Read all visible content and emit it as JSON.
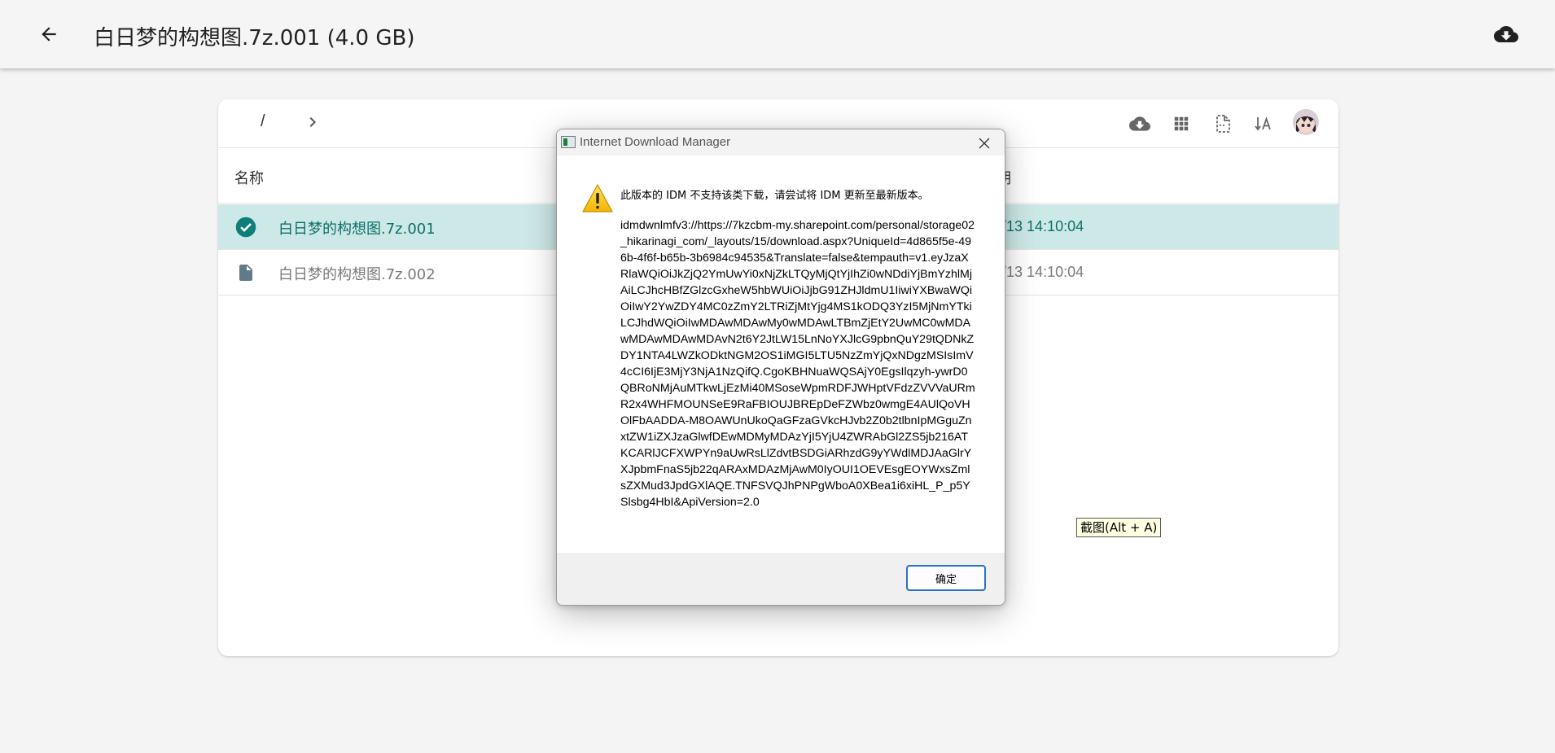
{
  "appbar": {
    "title": "白日梦的构想图.7z.001 (4.0 GB)",
    "back_icon": "arrow-left-icon",
    "download_icon": "cloud-download-icon"
  },
  "explorer": {
    "breadcrumb": {
      "root": "/",
      "separator_icon": "chevron-right-icon"
    },
    "toolbar_icons": [
      "cloud-download-icon",
      "grid-view-icon",
      "file-dashed-icon",
      "sort-text-icon",
      "avatar"
    ],
    "columns": {
      "name": "名称",
      "date_partial": "日期"
    },
    "rows": [
      {
        "name": "白日梦的构想图.7z.001",
        "date_partial": "4/8/13 14:10:04",
        "icon": "check-circle-icon",
        "selected": true
      },
      {
        "name": "白日梦的构想图.7z.002",
        "date_partial": "4/8/13 14:10:04",
        "icon": "file-icon",
        "selected": false
      }
    ]
  },
  "tooltip": {
    "text": "截图(Alt + A)"
  },
  "dialog": {
    "title": "Internet Download Manager",
    "message": "此版本的 IDM 不支持该类下载，请尝试将 IDM 更新至最新版本。",
    "url": "idmdwnlmfv3://https://7kzcbm-my.sharepoint.com/personal/storage02_hikarinagi_com/_layouts/15/download.aspx?UniqueId=4d865f5e-496b-4f6f-b65b-3b6984c94535&Translate=false&tempauth=v1.eyJzaXRlaWQiOiJkZjQ2YmUwYi0xNjZkLTQyMjQtYjIhZi0wNDdiYjBmYzhlMjAiLCJhcHBfZGlzcGxheW5hbWUiOiJjbG91ZHJldmU1IiwiYXBwaWQiOiIwY2YwZDY4MC0zZmY2LTRiZjMtYjg4MS1kODQ3YzI5MjNmYTkiLCJhdWQiOiIwMDAwMDAwMy0wMDAwLTBmZjEtY2UwMC0wMDAwMDAwMDAwMDAvN2t6Y2JtLW15LnNoYXJlcG9pbnQuY29tQDNkZDY1NTA4LWZkODktNGM2OS1iMGI5LTU5NzZmYjQxNDgzMSIsImV4cCI6IjE3MjY3NjA1NzQifQ.CgoKBHNuaWQSAjY0EgsIlqzyh-ywrD0QBRoNMjAuMTkwLjEzMi40MSoseWpmRDFJWHptVFdzZVVVaURmR2x4WHFMOUNSeE9RaFBIOUJBREpDeFZWbz0wmgE4AUlQoVHOlFbAADDA-M8OAWUnUkoQaGFzaGVkcHJvb2Z0b2tlbnIpMGguZnxtZW1iZXJzaGlwfDEwMDMyMDAzYjI5YjU4ZWRAbGl2ZS5jb216ATKCARlJCFXWPYn9aUwRsLlZdvtBSDGiARhzdG9yYWdlMDJAaGlrYXJpbmFnaS5jb22qARAxMDAzMjAwM0IyOUI1OEVEsgEOYWxsZmlsZXMud3JpdGXlAQE.TNFSVQJhPNPgWboA0XBea1i6xiHL_P_p5YSlsbg4HbI&ApiVersion=2.0",
    "ok_label": "确定",
    "warning_icon": "warning-icon",
    "close_icon": "close-icon"
  }
}
